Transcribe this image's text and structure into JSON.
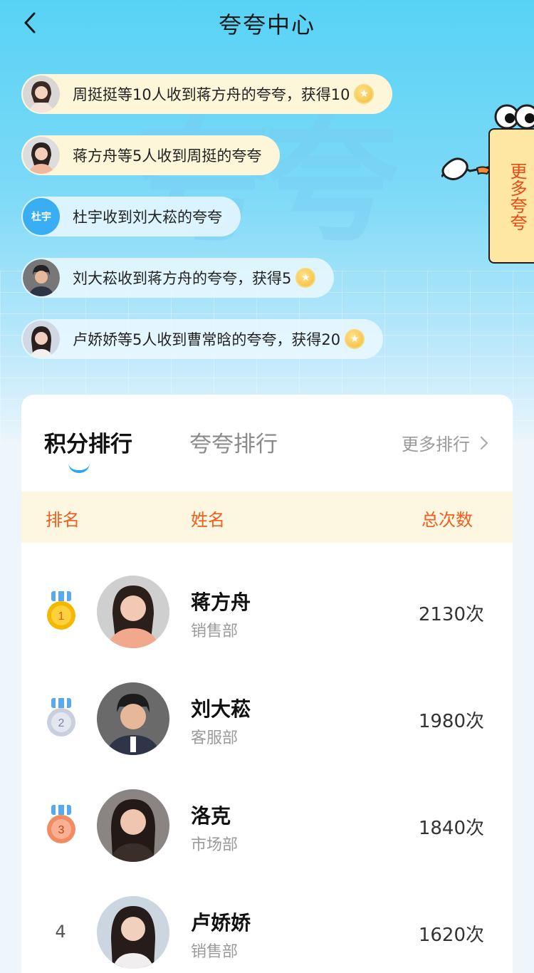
{
  "header": {
    "title": "夸夸中心"
  },
  "feed": [
    {
      "text": "周挺挺等10人收到蒋方舟的夸夸，获得10",
      "coin": true,
      "style": "yellow"
    },
    {
      "text": "蒋方舟等5人收到周挺的夸夸",
      "coin": false,
      "style": "yellow"
    },
    {
      "text": "杜宇收到刘大菘的夸夸",
      "coin": false,
      "style": "light",
      "avatar_text": "杜宇"
    },
    {
      "text": "刘大菘收到蒋方舟的夸夸，获得5",
      "coin": true,
      "style": "light"
    },
    {
      "text": "卢娇娇等5人收到曹常晗的夸夸，获得20",
      "coin": true,
      "style": "light"
    }
  ],
  "more_tag": {
    "label": "更多夸夸"
  },
  "watermark": "夸夸",
  "tabs": [
    {
      "label": "积分排行",
      "active": true
    },
    {
      "label": "夸夸排行",
      "active": false
    }
  ],
  "more_rank": {
    "label": "更多排行"
  },
  "table": {
    "headers": {
      "rank": "排名",
      "name": "姓名",
      "total": "总次数"
    },
    "rows": [
      {
        "rank": "1",
        "name": "蒋方舟",
        "dept": "销售部",
        "count": "2130次",
        "medal": "gold"
      },
      {
        "rank": "2",
        "name": "刘大菘",
        "dept": "客服部",
        "count": "1980次",
        "medal": "silver"
      },
      {
        "rank": "3",
        "name": "洛克",
        "dept": "市场部",
        "count": "1840次",
        "medal": "bronze"
      },
      {
        "rank": "4",
        "name": "卢娇娇",
        "dept": "销售部",
        "count": "1620次",
        "medal": "none"
      }
    ]
  },
  "colors": {
    "accent": "#29a7ef",
    "header_text": "#ee5f1f",
    "gold": "#f5b800",
    "silver": "#c9cfdc",
    "bronze": "#f08b62"
  }
}
